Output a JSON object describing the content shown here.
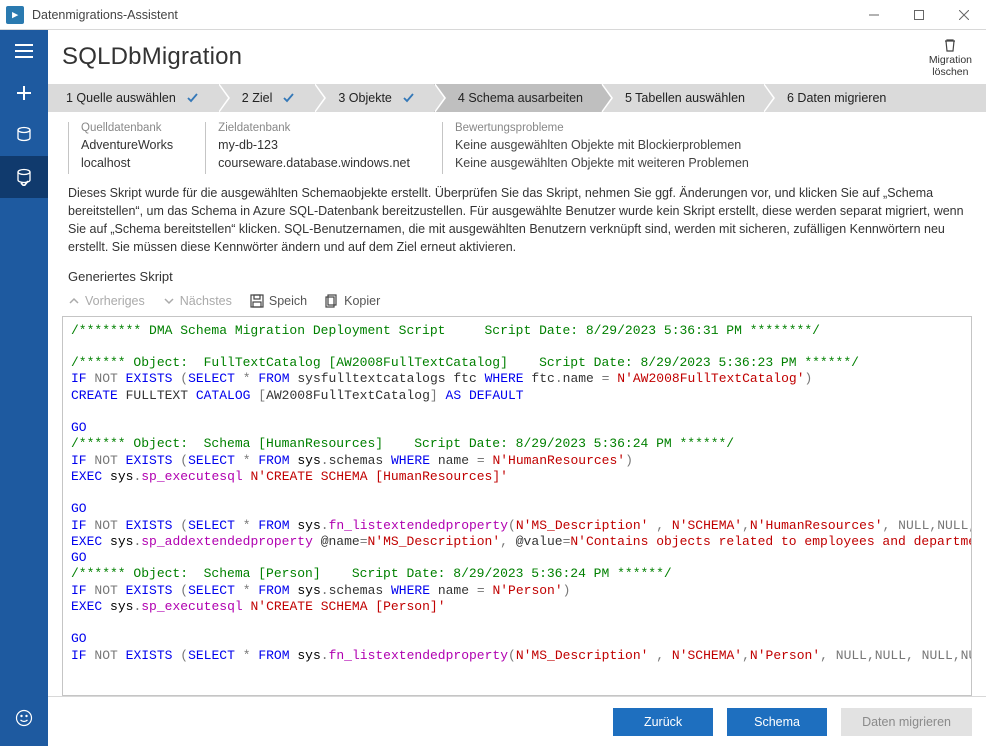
{
  "window": {
    "title": "Datenmigrations-Assistent"
  },
  "header": {
    "page_title": "SQLDbMigration",
    "delete_migration": {
      "line1": "Migration",
      "line2": "löschen"
    }
  },
  "steps": [
    {
      "label": "1   Quelle auswählen",
      "checked": true
    },
    {
      "label": "2   Ziel",
      "checked": true
    },
    {
      "label": "3   Objekte",
      "checked": true
    },
    {
      "label": "4   Schema ausarbeiten",
      "checked": false,
      "active": true
    },
    {
      "label": "5 Tabellen auswählen",
      "checked": false
    },
    {
      "label": "6 Daten migrieren",
      "checked": false
    }
  ],
  "info": {
    "source": {
      "label": "Quelldatenbank",
      "db": "AdventureWorks",
      "server": "localhost"
    },
    "target": {
      "label": "Zieldatenbank",
      "db": "my-db-123",
      "server": "courseware.database.windows.net"
    },
    "issues": {
      "label": "Bewertungsprobleme",
      "blocking": "Keine ausgewählten Objekte mit Blockierproblemen",
      "other": "Keine ausgewählten Objekte mit weiteren Problemen"
    }
  },
  "description": "Dieses Skript wurde für die ausgewählten Schemaobjekte erstellt. Überprüfen Sie das Skript, nehmen Sie ggf. Änderungen vor, und klicken Sie auf „Schema bereitstellen“, um das Schema in Azure SQL-Datenbank bereitzustellen. Für ausgewählte Benutzer wurde kein Skript erstellt, diese werden separat migriert, wenn Sie auf „Schema bereitstellen“ klicken. SQL-Benutzernamen, die mit ausgewählten Benutzern verknüpft sind, werden mit sicheren, zufälligen Kennwörtern neu erstellt. Sie müssen diese Kennwörter ändern und auf dem Ziel erneut aktivieren.",
  "section_title": "Generiertes Skript",
  "toolbar": {
    "previous": "Vorheriges",
    "next": "Nächstes",
    "save": "Speich",
    "copy": "Kopier"
  },
  "footer": {
    "back": "Zurück",
    "deploy": "Schema",
    "migrate": "Daten migrieren"
  },
  "script": {
    "date_main": "8/29/2023 5:36:31 PM",
    "date_ftc": "8/29/2023 5:36:23 PM",
    "date_hr": "8/29/2023 5:36:24 PM",
    "date_person": "8/29/2023 5:36:24 PM"
  }
}
